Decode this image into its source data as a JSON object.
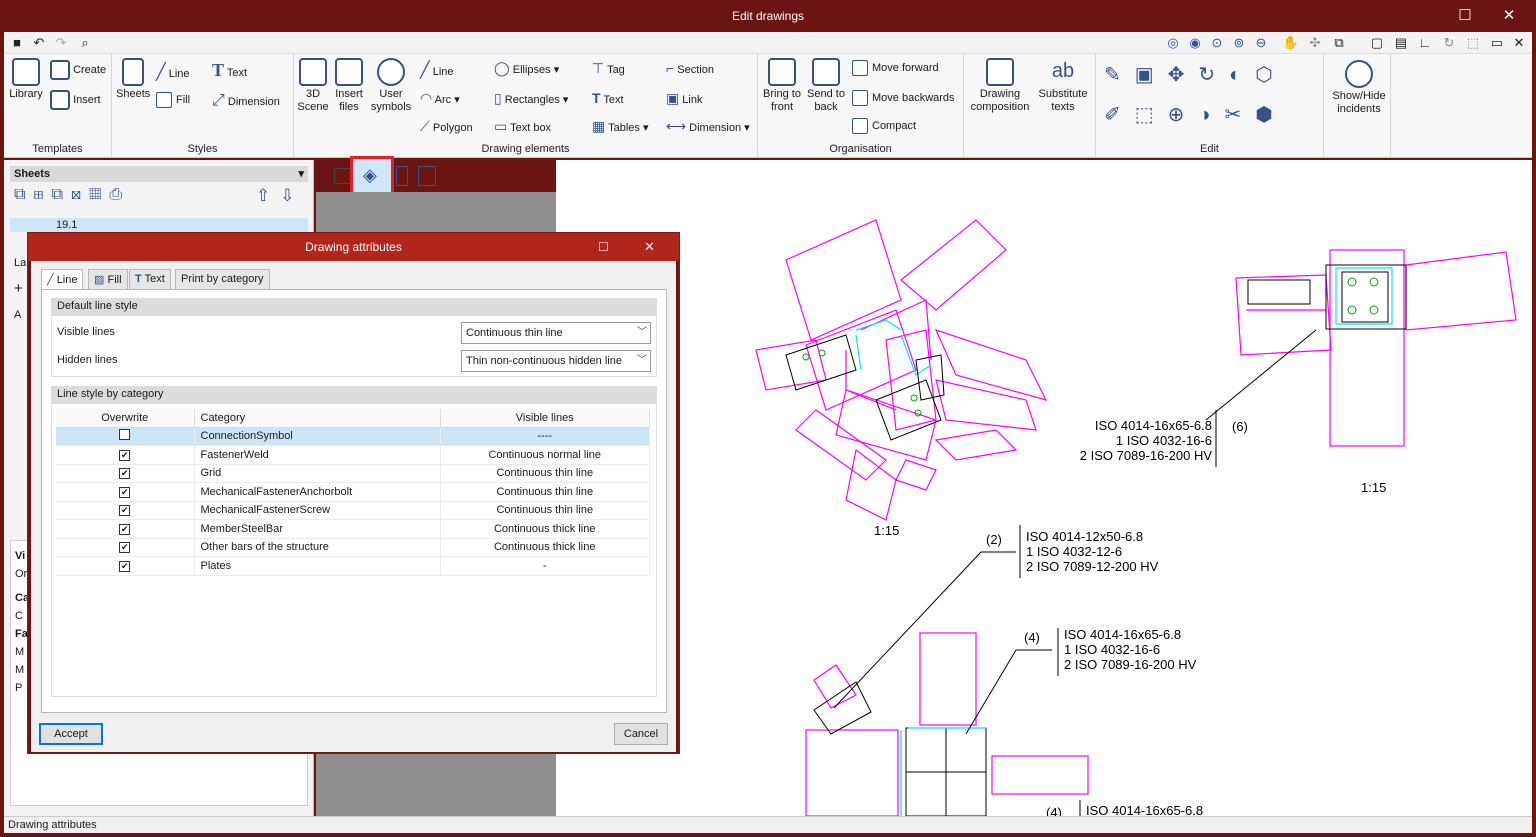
{
  "window": {
    "title": "Edit drawings",
    "minimize": "☐",
    "close": "✕"
  },
  "ribbon": {
    "templates": {
      "label": "Templates",
      "library": "Library",
      "create": "Create",
      "insert": "Insert"
    },
    "styles": {
      "label": "Styles",
      "sheets": "Sheets",
      "line": "Line",
      "text": "Text",
      "fill": "Fill",
      "dimension": "Dimension"
    },
    "drawing_elements": {
      "label": "Drawing elements",
      "scene3d": "3D Scene",
      "insert_files": "Insert files",
      "user_symbols": "User symbols",
      "line": "Line",
      "arc": "Arc",
      "polygon": "Polygon",
      "ellipses": "Ellipses",
      "rectangles": "Rectangles",
      "text_box": "Text box",
      "tag": "Tag",
      "text": "Text",
      "tables": "Tables",
      "section": "Section",
      "link": "Link",
      "dimension": "Dimension"
    },
    "organisation": {
      "label": "Organisation",
      "bring_to_front": "Bring to front",
      "send_to_back": "Send to back",
      "move_forward": "Move forward",
      "move_backwards": "Move backwards",
      "compact": "Compact"
    },
    "drawing_composition": "Drawing composition",
    "substitute_texts": "Substitute texts",
    "edit": {
      "label": "Edit"
    },
    "show_hide_incidents": "Show/Hide incidents"
  },
  "left_panel": {
    "sheets_header": "Sheets",
    "sheet_item": "19.1",
    "labels": [
      "La",
      "+",
      "A",
      "Vi",
      "Or",
      "Ca",
      "C",
      "Fa",
      "M",
      "M",
      "P"
    ]
  },
  "dialog": {
    "title": "Drawing attributes",
    "tabs": [
      "Line",
      "Fill",
      "Text",
      "Print by category"
    ],
    "default_section": "Default line style",
    "visible_lines_label": "Visible lines",
    "visible_lines_value": "Continuous thin line",
    "hidden_lines_label": "Hidden lines",
    "hidden_lines_value": "Thin non-continuous hidden line",
    "category_section": "Line style by category",
    "columns": [
      "Overwrite",
      "Category",
      "Visible lines"
    ],
    "rows": [
      {
        "checked": false,
        "category": "ConnectionSymbol",
        "visible": "----"
      },
      {
        "checked": true,
        "category": "FastenerWeld",
        "visible": "Continuous normal line"
      },
      {
        "checked": true,
        "category": "Grid",
        "visible": "Continuous thin line"
      },
      {
        "checked": true,
        "category": "MechanicalFastenerAnchorbolt",
        "visible": "Continuous thin line"
      },
      {
        "checked": true,
        "category": "MechanicalFastenerScrew",
        "visible": "Continuous thin line"
      },
      {
        "checked": true,
        "category": "MemberSteelBar",
        "visible": "Continuous thick line"
      },
      {
        "checked": true,
        "category": "Other bars of the structure",
        "visible": "Continuous thick line"
      },
      {
        "checked": true,
        "category": "Plates",
        "visible": "-"
      }
    ],
    "accept": "Accept",
    "cancel": "Cancel"
  },
  "drawing": {
    "scale1": "1:15",
    "scale2": "1:15",
    "label6": {
      "tag": "(6)",
      "lines": [
        "ISO 4014-16x65-6.8",
        "1 ISO 4032-16-6",
        "2 ISO 7089-16-200 HV"
      ]
    },
    "label2": {
      "tag": "(2)",
      "lines": [
        "ISO 4014-12x50-6.8",
        "1 ISO 4032-12-6",
        "2 ISO 7089-12-200 HV"
      ]
    },
    "label4": {
      "tag": "(4)",
      "lines": [
        "ISO 4014-16x65-6.8",
        "1 ISO 4032-16-6",
        "2 ISO 7089-16-200 HV"
      ]
    },
    "label4b": {
      "tag": "(4)",
      "line": "ISO 4014-16x65-6.8"
    }
  },
  "status": "Drawing attributes",
  "colors": {
    "frame": "#6b1512",
    "dialog_title": "#b1251a",
    "highlight": "#e0202b",
    "magenta": "#ff00ff",
    "cyan": "#00e5ff"
  }
}
